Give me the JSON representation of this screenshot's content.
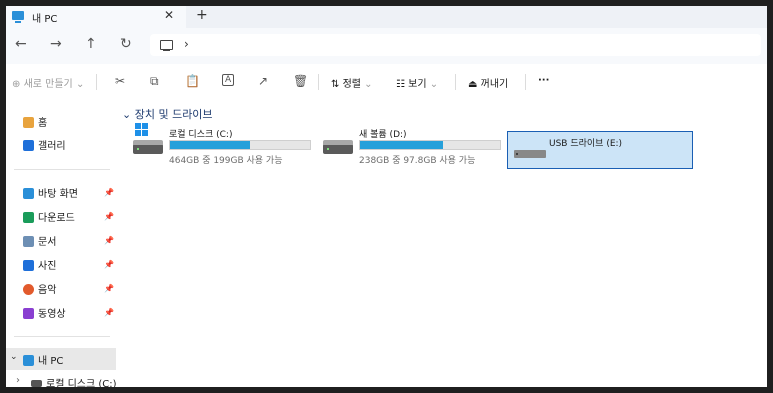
{
  "tab": {
    "title": "내 PC",
    "close": "✕",
    "new_tab": "+"
  },
  "nav": {
    "back": "←",
    "forward": "→",
    "up": "↑",
    "refresh": "↻",
    "breadcrumb_sep": "›"
  },
  "toolbar": {
    "new": "새로 만들기",
    "sort": "정렬",
    "view": "보기",
    "eject": "꺼내기",
    "more": "···",
    "cut_icon": "✂",
    "copy_icon": "⧉",
    "paste_icon": "📋",
    "rename_icon": "A",
    "share_icon": "↗",
    "delete_icon": "🗑"
  },
  "sidebar": {
    "home": "홈",
    "gallery": "갤러리",
    "desktop": "바탕 화면",
    "downloads": "다운로드",
    "documents": "문서",
    "pictures": "사진",
    "music": "음악",
    "videos": "동영상",
    "this_pc": "내 PC",
    "local_disk": "로컬 디스크 (C:)"
  },
  "main": {
    "section_title": "장치 및 드라이브",
    "drives": [
      {
        "name": "로컬 디스크 (C:)",
        "info": "464GB 중 199GB 사용 가능",
        "used_pct": 57
      },
      {
        "name": "새 볼륨 (D:)",
        "info": "238GB 중 97.8GB 사용 가능",
        "used_pct": 59
      },
      {
        "name": "USB 드라이브 (E:)"
      }
    ]
  },
  "colors": {
    "accent": "#26a0da",
    "selection": "#cce4f7",
    "selection_border": "#1a5fb4"
  }
}
